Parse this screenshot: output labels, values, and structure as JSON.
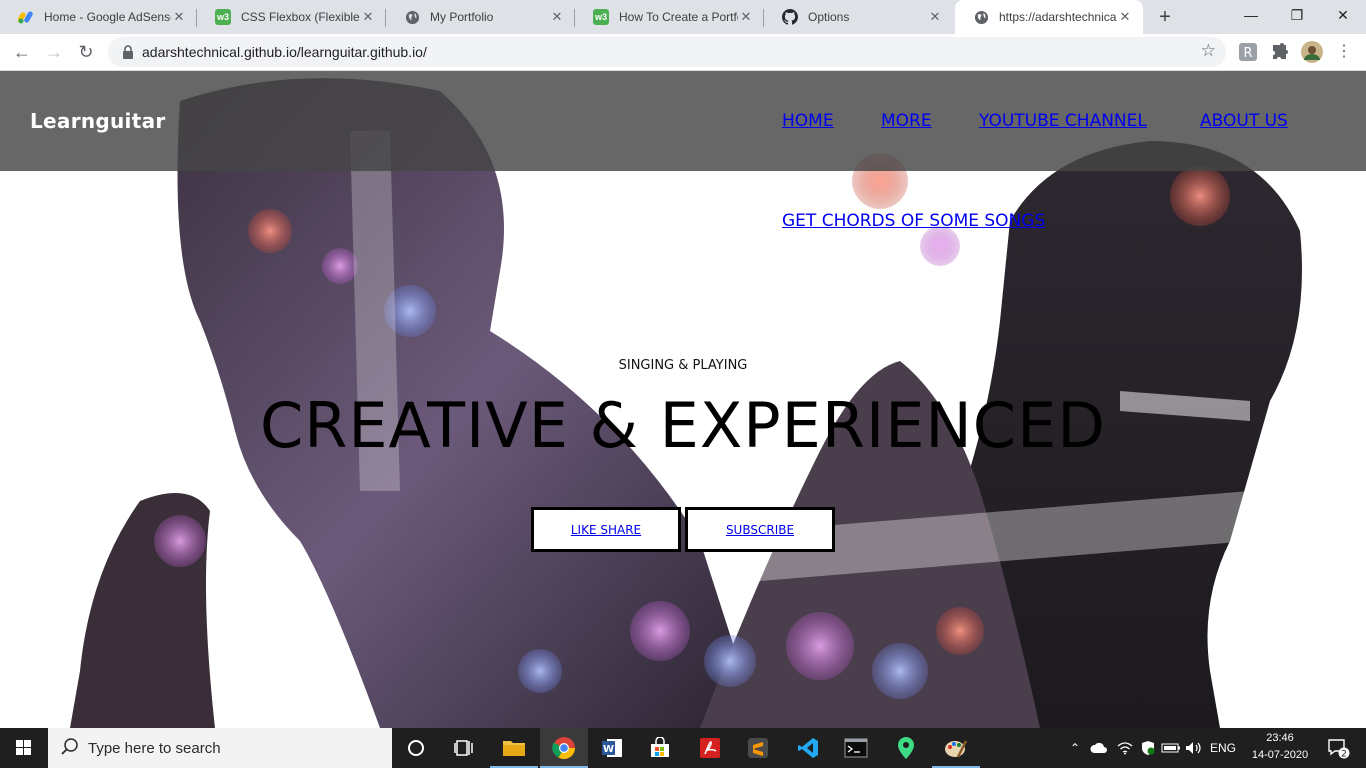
{
  "browser": {
    "tabs": [
      {
        "title": "Home - Google AdSense",
        "favicon": "adsense-icon"
      },
      {
        "title": "CSS Flexbox (Flexible Box)",
        "favicon": "w3schools-icon"
      },
      {
        "title": "My Portfolio",
        "favicon": "globe-icon"
      },
      {
        "title": "How To Create a Portfolio",
        "favicon": "w3schools-icon"
      },
      {
        "title": "Options",
        "favicon": "github-icon"
      },
      {
        "title": "https://adarshtechnical.github.io",
        "favicon": "globe-icon"
      }
    ],
    "address": "adarshtechnical.github.io/learnguitar.github.io/"
  },
  "site": {
    "brand": "Learnguitar",
    "nav": {
      "home": "HOME",
      "more": "MORE",
      "youtube": "YOUTUBE CHANNEL",
      "about": "ABOUT US",
      "chords": "GET CHORDS OF SOME SONGS"
    },
    "hero": {
      "eyebrow": "SINGING & PLAYING",
      "headline": "CREATIVE & EXPERIENCED",
      "btn_like": "LIKE SHARE",
      "btn_subscribe": "SUBSCRIBE"
    }
  },
  "taskbar": {
    "search_placeholder": "Type here to search",
    "language": "ENG",
    "time": "23:46",
    "date": "14-07-2020",
    "notification_count": "2"
  },
  "colors": {
    "link": "#0000ee",
    "nav_overlay": "#464646",
    "chrome_tabstrip": "#dee1e6",
    "taskbar": "#1f1f1f"
  }
}
